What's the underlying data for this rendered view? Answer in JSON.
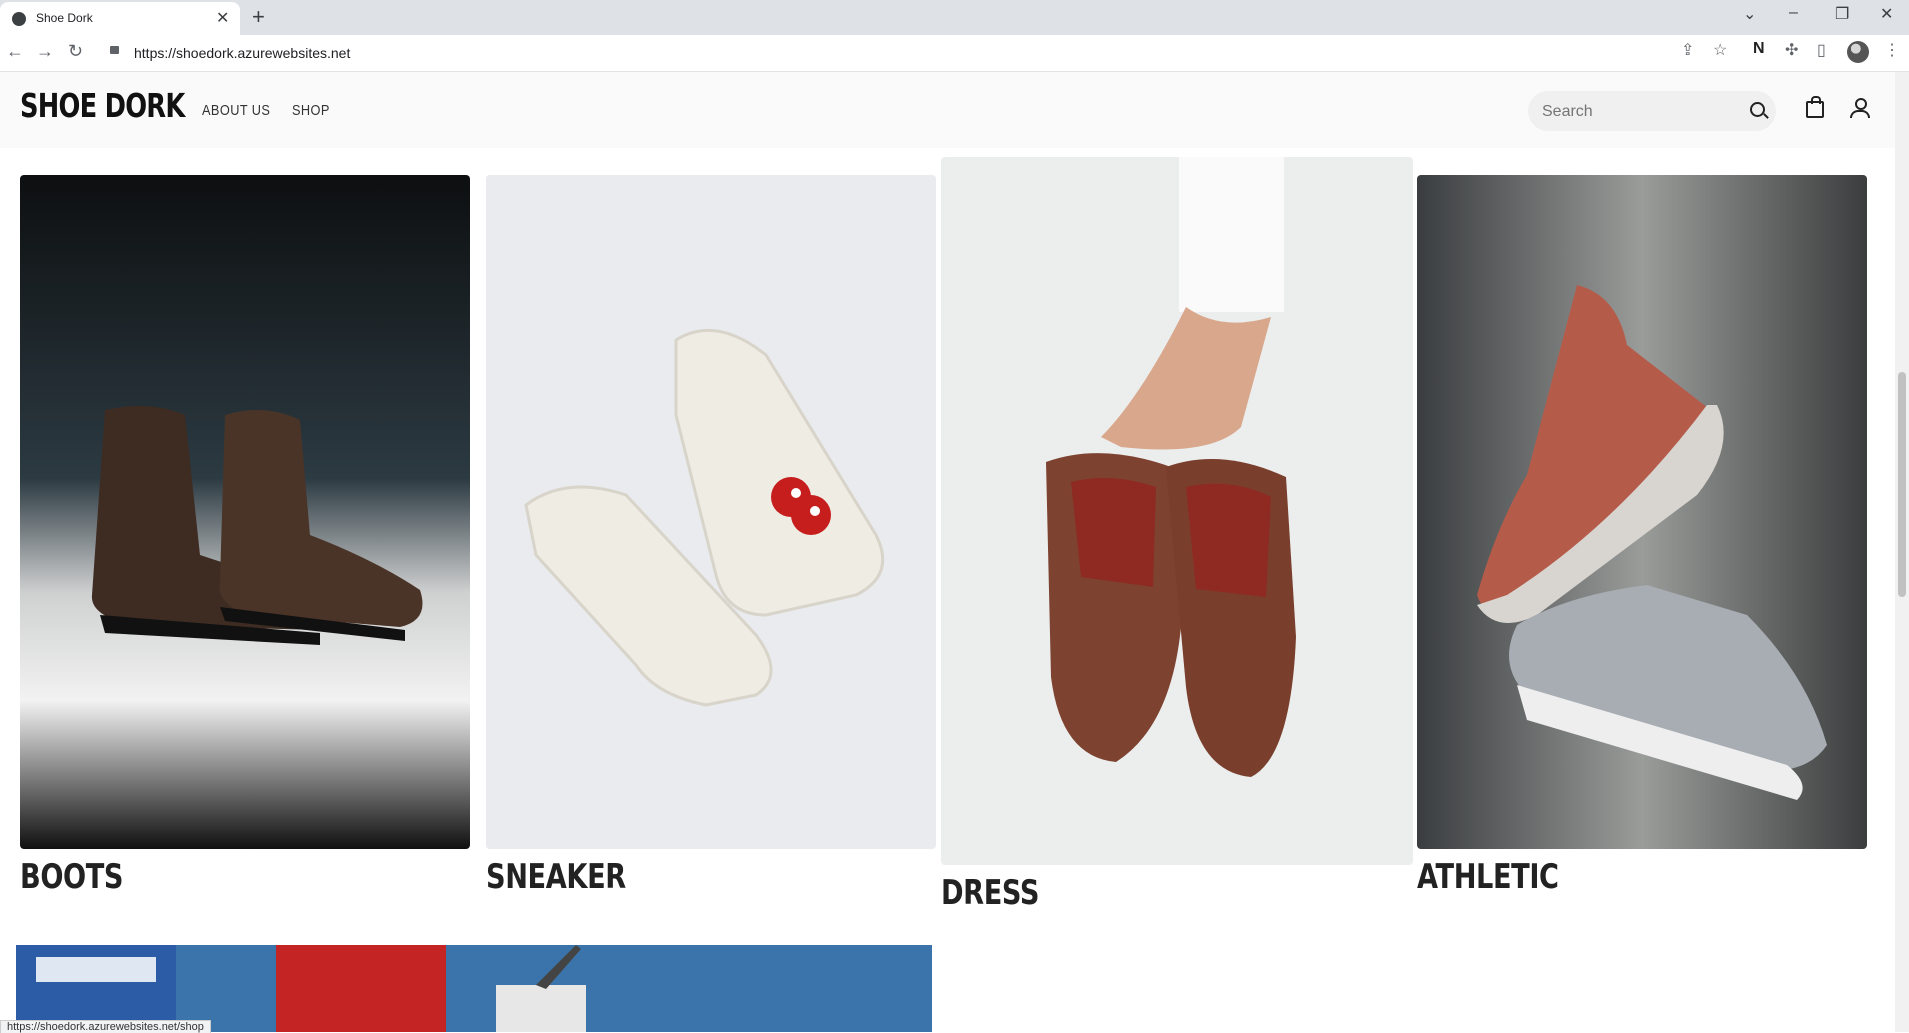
{
  "browser": {
    "tab_title": "Shoe Dork",
    "url": "https://shoedork.azurewebsites.net",
    "status_url": "https://shoedork.azurewebsites.net/shop"
  },
  "site": {
    "logo": "SHOE DORK",
    "nav": [
      "ABOUT US",
      "SHOP"
    ],
    "search_placeholder": "Search"
  },
  "categories": [
    {
      "label": "BOOTS"
    },
    {
      "label": "SNEAKER"
    },
    {
      "label": "DRESS"
    },
    {
      "label": "ATHLETIC"
    }
  ],
  "icons": {
    "search": "search-icon",
    "bag": "shopping-bag-icon",
    "account": "user-account-icon"
  }
}
